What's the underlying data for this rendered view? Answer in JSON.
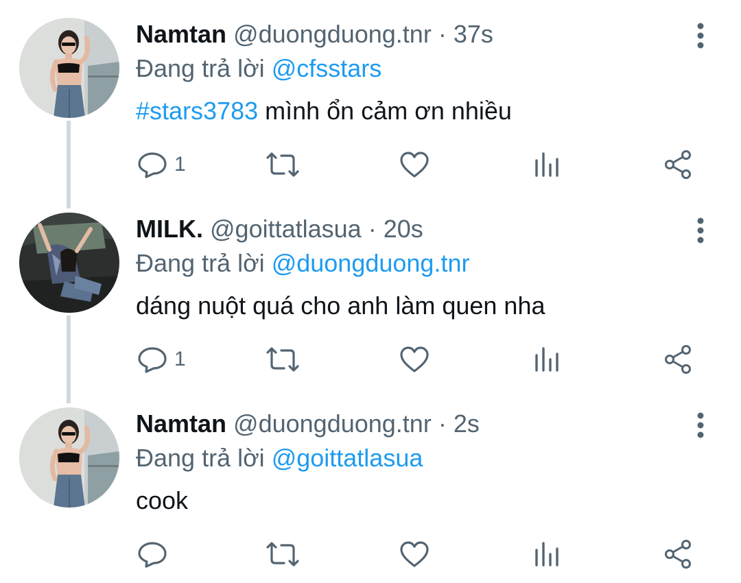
{
  "tweets": [
    {
      "name": "Namtan",
      "handle": "@duongduong.tnr",
      "separator": " · ",
      "time": "37s",
      "reply_prefix": "Đang trả lời ",
      "reply_to": "@cfsstars",
      "hashtag": "#stars3783",
      "text": " mình ổn cảm ơn nhiều",
      "reply_count": "1",
      "avatar": "avatar-woman-balcony"
    },
    {
      "name": "MILK.",
      "handle": "@goittatlasua",
      "separator": " · ",
      "time": "20s",
      "reply_prefix": "Đang trả lời ",
      "reply_to": "@duongduong.tnr",
      "hashtag": "",
      "text": "dáng nuột quá cho anh làm quen nha",
      "reply_count": "1",
      "avatar": "avatar-person-car"
    },
    {
      "name": "Namtan",
      "handle": "@duongduong.tnr",
      "separator": " · ",
      "time": "2s",
      "reply_prefix": "Đang trả lời ",
      "reply_to": "@goittatlasua",
      "hashtag": "",
      "text": "cook",
      "reply_count": "",
      "avatar": "avatar-woman-balcony"
    }
  ],
  "icons": {
    "reply": "reply-icon",
    "retweet": "retweet-icon",
    "like": "like-icon",
    "views": "views-icon",
    "share": "share-icon",
    "more": "more-vertical-icon"
  },
  "colors": {
    "accent": "#1d9bf0",
    "secondary_text": "#536471",
    "thread_line": "#cfd9de"
  }
}
